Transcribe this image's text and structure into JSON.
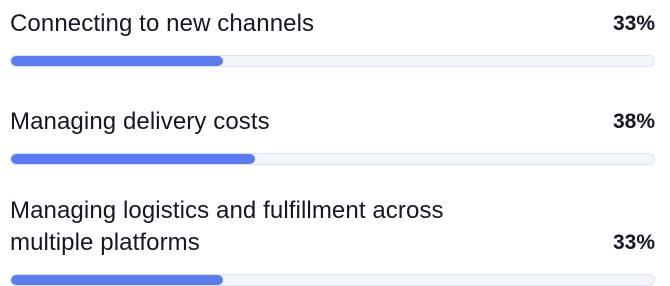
{
  "accent_color": "#5a7cf0",
  "track_color": "#f3f5fc",
  "items": [
    {
      "label": "Connecting to new channels",
      "value_text": "33%",
      "progress": 0.33
    },
    {
      "label": "Managing delivery costs",
      "value_text": "38%",
      "progress": 0.38
    },
    {
      "label": "Managing logistics and fulfillment across multiple platforms",
      "value_text": "33%",
      "progress": 0.33
    }
  ]
}
